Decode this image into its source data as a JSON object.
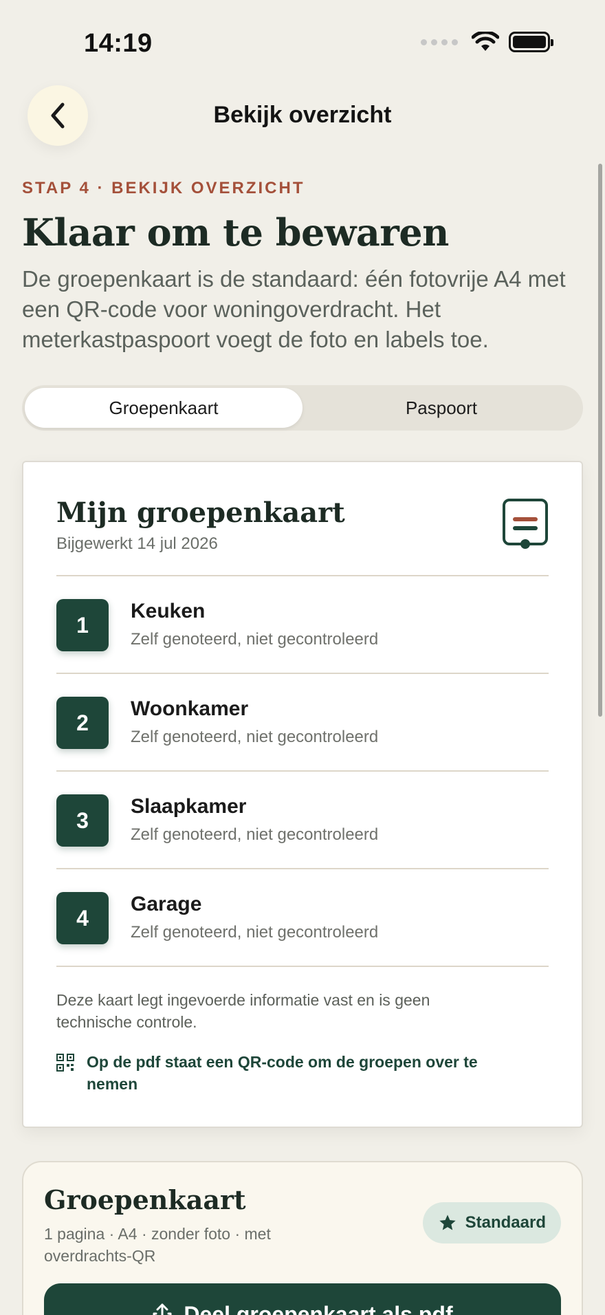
{
  "status_bar": {
    "time": "14:19"
  },
  "nav": {
    "title": "Bekijk overzicht"
  },
  "header": {
    "step": "STAP 4 · BEKIJK OVERZICHT",
    "title": "Klaar om te bewaren",
    "intro": "De groepenkaart is de standaard: één fotovrije A4 met een QR-code voor woningoverdracht. Het meterkastpaspoort voegt de foto en labels toe."
  },
  "tabs": [
    {
      "label": "Groepenkaart",
      "selected": true
    },
    {
      "label": "Paspoort",
      "selected": false
    }
  ],
  "card": {
    "title": "Mijn groepenkaart",
    "subtitle": "Bijgewerkt 14 jul 2026",
    "groups": [
      {
        "number": "1",
        "name": "Keuken",
        "status": "Zelf genoteerd, niet gecontroleerd"
      },
      {
        "number": "2",
        "name": "Woonkamer",
        "status": "Zelf genoteerd, niet gecontroleerd"
      },
      {
        "number": "3",
        "name": "Slaapkamer",
        "status": "Zelf genoteerd, niet gecontroleerd"
      },
      {
        "number": "4",
        "name": "Garage",
        "status": "Zelf genoteerd, niet gecontroleerd"
      }
    ],
    "note": "Deze kaart legt ingevoerde informatie vast en is geen technische controle.",
    "qr_note": "Op de pdf staat een QR-code om de groepen over te nemen"
  },
  "export": {
    "title": "Groepenkaart",
    "meta": "1 pagina · A4 · zonder foto · met overdrachts-QR",
    "badge": "Standaard",
    "button": "Deel groepenkaart als pdf"
  },
  "colors": {
    "accent": "#1e4639",
    "step_label": "#a4503a",
    "background": "#f1efe8"
  }
}
